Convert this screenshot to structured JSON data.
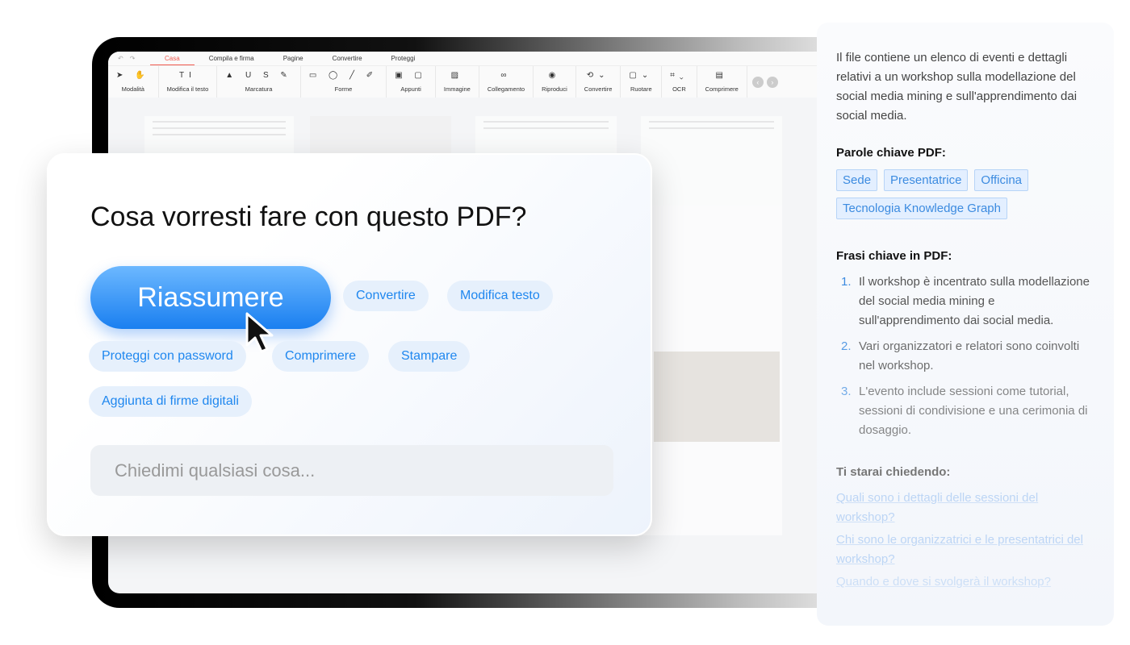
{
  "toolbar": {
    "tabs": [
      "Casa",
      "Compila e firma",
      "Pagine",
      "Convertire",
      "Proteggi"
    ],
    "groups": [
      {
        "label": "Modalità",
        "icons": "➤ ✋"
      },
      {
        "label": "Modifica il testo",
        "icons": "TI"
      },
      {
        "label": "Marcatura",
        "icons": "▲ U S ✎"
      },
      {
        "label": "Forme",
        "icons": "▭ ◯ ╱ ✐"
      },
      {
        "label": "Appunti",
        "icons": "▣ ▢"
      },
      {
        "label": "Immagine",
        "icons": "▨"
      },
      {
        "label": "Collegamento",
        "icons": "∞"
      },
      {
        "label": "Riproduci",
        "icons": "◉"
      },
      {
        "label": "Convertire",
        "icons": "⟲⌄"
      },
      {
        "label": "Ruotare",
        "icons": "▢⌄"
      },
      {
        "label": "OCR",
        "icons": "⌗⌄"
      },
      {
        "label": "Comprimere",
        "icons": "▤"
      }
    ]
  },
  "dialog": {
    "title": "Cosa vorresti fare con questo PDF?",
    "primary": "Riassumere",
    "chips": [
      "Convertire",
      "Modifica testo",
      "Proteggi con password",
      "Comprimere",
      "Stampare",
      "Aggiunta di firme digitali"
    ],
    "placeholder": "Chiedimi qualsiasi cosa..."
  },
  "panel": {
    "summary": "Il file contiene un elenco di eventi e dettagli relativi a un workshop sulla modellazione del social media mining e sull'apprendimento dai social media.",
    "keywords_title": "Parole chiave PDF:",
    "keywords": [
      "Sede",
      "Presentatrice",
      "Officina",
      "Tecnologia Knowledge Graph"
    ],
    "phrases_title": "Frasi chiave in PDF:",
    "phrases": [
      "Il workshop è incentrato sulla modellazione del social media mining e sull'apprendimento dai social media.",
      "Vari organizzatori e relatori sono coinvolti nel workshop.",
      "L'evento include sessioni come tutorial, sessioni di condivisione e una cerimonia di dosaggio."
    ],
    "questions_title": "Ti starai chiedendo:",
    "questions": [
      "Quali sono i dettagli delle sessioni del workshop?",
      "Chi sono le organizzatrici e le presentatrici del workshop?",
      "Quando e dove si svolgerà il workshop?"
    ]
  }
}
